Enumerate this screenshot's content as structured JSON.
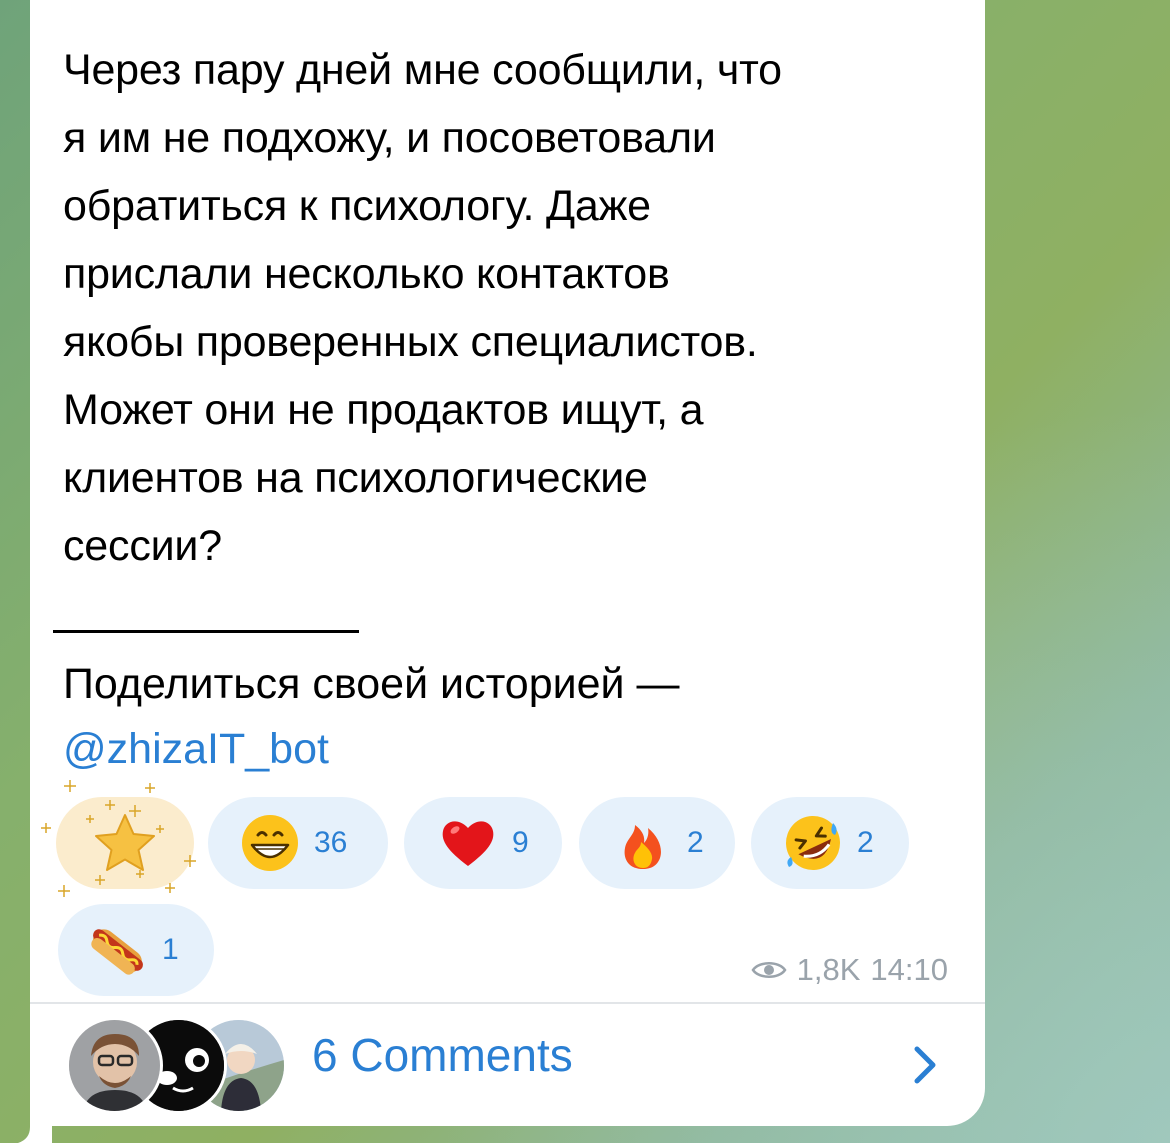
{
  "message": {
    "body": "Через пару дней мне сообщили, что\nя им не подхожу, и посоветовали\nобратиться к психологу. Даже\nприслали несколько контактов\nякобы проверенных специалистов.\nМожет они не продактов ищут, а\nклиентов на психологические\nсессии?",
    "share_text": "Поделиться своей историей —",
    "bot_link": "@zhizaIT_bot"
  },
  "reactions": [
    {
      "icon": "star-emoji",
      "count": "",
      "paid": true
    },
    {
      "icon": "grinning-face-emoji",
      "count": "36"
    },
    {
      "icon": "red-heart-emoji",
      "count": "9"
    },
    {
      "icon": "fire-emoji",
      "count": "2"
    },
    {
      "icon": "rolling-laughing-face-emoji",
      "count": "2"
    },
    {
      "icon": "hot-dog-emoji",
      "count": "1"
    }
  ],
  "meta": {
    "views": "1,8K",
    "time": "14:10"
  },
  "comments": {
    "label": "6 Comments"
  },
  "colors": {
    "link": "#2a7fd3",
    "reaction_bg": "#e6f1fb",
    "paid_bg": "#fbeccd",
    "meta": "#9aa3ab"
  }
}
